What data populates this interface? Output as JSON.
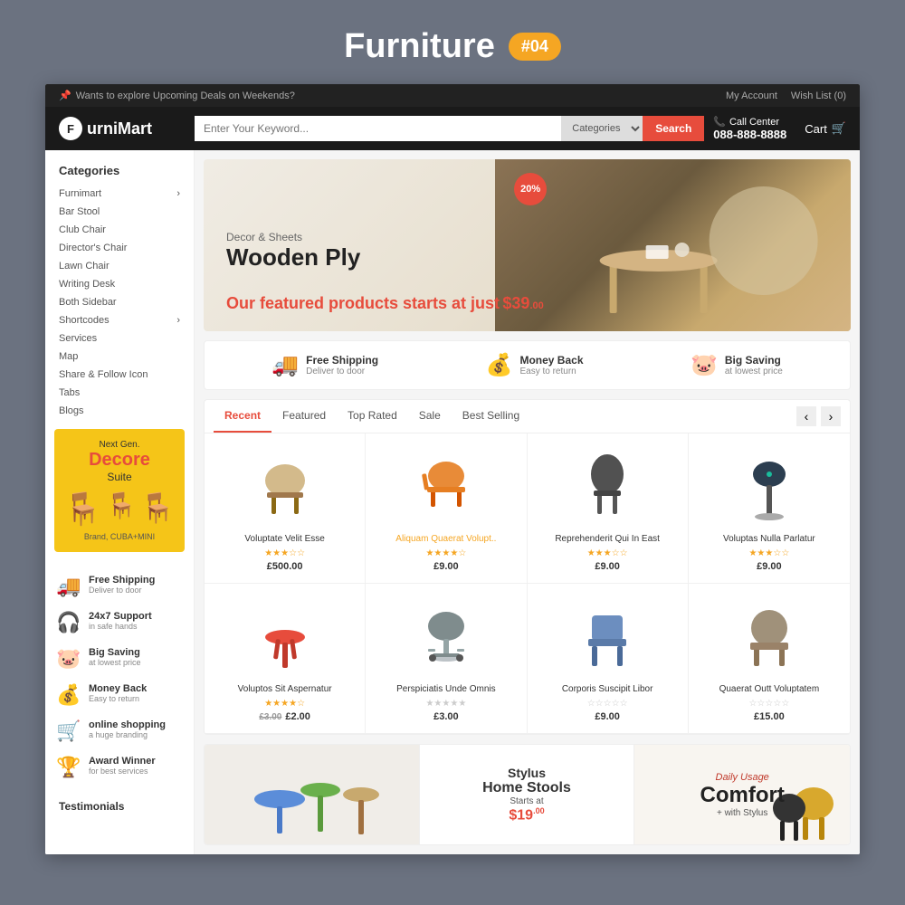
{
  "page": {
    "title": "Furniture",
    "badge": "#04",
    "bg_color": "#6b7280"
  },
  "topbar": {
    "announcement": "Wants to explore Upcoming Deals on Weekends?",
    "my_account": "My Account",
    "wish_list": "Wish List (0)",
    "pin_icon": "📌"
  },
  "header": {
    "logo_letter": "F",
    "logo_name": "urniMart",
    "search_placeholder": "Enter Your Keyword...",
    "search_cat": "Categories",
    "search_btn": "Search",
    "call_label": "Call Center",
    "call_number": "088-888-8888",
    "cart_label": "Cart",
    "cart_icon": "🛒"
  },
  "sidebar": {
    "categories_title": "Categories",
    "menu_items": [
      {
        "label": "Furnimart",
        "has_arrow": true
      },
      {
        "label": "Bar Stool",
        "has_arrow": false
      },
      {
        "label": "Club Chair",
        "has_arrow": false
      },
      {
        "label": "Director's Chair",
        "has_arrow": false
      },
      {
        "label": "Lawn Chair",
        "has_arrow": false
      },
      {
        "label": "Writing Desk",
        "has_arrow": false
      },
      {
        "label": "Both Sidebar",
        "has_arrow": false
      },
      {
        "label": "Shortcodes",
        "has_arrow": true
      },
      {
        "label": "Services",
        "has_arrow": false
      },
      {
        "label": "Map",
        "has_arrow": false
      },
      {
        "label": "Share & Follow Icon",
        "has_arrow": false
      },
      {
        "label": "Tabs",
        "has_arrow": false
      },
      {
        "label": "Blogs",
        "has_arrow": false
      }
    ],
    "promo": {
      "small": "Next Gen.",
      "big": "Decore",
      "medium": "Suite",
      "brand": "Brand, CUBA+MINI"
    },
    "features": [
      {
        "icon": "🚚",
        "title": "Free Shipping",
        "sub": "Deliver to door"
      },
      {
        "icon": "🎧",
        "title": "24x7 Support",
        "sub": "in safe hands"
      },
      {
        "icon": "🐷",
        "title": "Big Saving",
        "sub": "at lowest price"
      },
      {
        "icon": "💰",
        "title": "Money Back",
        "sub": "Easy to return"
      },
      {
        "icon": "🛒",
        "title": "online shopping",
        "sub": "a huge branding"
      },
      {
        "icon": "🏆",
        "title": "Award Winner",
        "sub": "for best services"
      }
    ],
    "testimonials_label": "Testimonials"
  },
  "hero": {
    "badge": "20%",
    "sub": "Decor & Sheets",
    "main": "Wooden Ply",
    "price_text": "Our featured products starts at just",
    "price": "$39",
    "price_cents": ".00"
  },
  "features_strip": [
    {
      "icon": "🚚",
      "title": "Free Shipping",
      "sub": "Deliver to door"
    },
    {
      "icon": "💰",
      "title": "Money Back",
      "sub": "Easy to return"
    },
    {
      "icon": "🐷",
      "title": "Big Saving",
      "sub": "at lowest price"
    }
  ],
  "product_tabs": {
    "tabs": [
      "Recent",
      "Featured",
      "Top Rated",
      "Sale",
      "Best Selling"
    ],
    "active": "Recent"
  },
  "products": [
    {
      "icon": "🪑",
      "name": "Voluptate Velit Esse",
      "price": "£500.00",
      "stars": 3,
      "color": "normal",
      "icon_style": "wooden-chair"
    },
    {
      "icon": "🪑",
      "name": "Aliquam Quaerat Volupt..",
      "price": "£9.00",
      "stars": 4,
      "color": "orange",
      "icon_style": "orange-chair"
    },
    {
      "icon": "🪑",
      "name": "Reprehenderit Qui In East",
      "price": "£9.00",
      "stars": 3,
      "color": "normal",
      "icon_style": "dark-chair"
    },
    {
      "icon": "🪑",
      "name": "Voluptas Nulla Parlatur",
      "price": "£9.00",
      "stars": 3,
      "color": "normal",
      "icon_style": "stool"
    },
    {
      "icon": "🪑",
      "name": "Voluptos Sit Aspernatur",
      "old_price": "£3.00",
      "price": "£2.00",
      "stars": 4,
      "color": "normal",
      "icon_style": "red-table"
    },
    {
      "icon": "🪑",
      "name": "Perspiciatis Unde Omnis",
      "price": "£3.00",
      "stars": 0,
      "color": "normal",
      "icon_style": "office-chair"
    },
    {
      "icon": "🪑",
      "name": "Corporis Suscipit Libor",
      "price": "£9.00",
      "stars": 0,
      "color": "normal",
      "icon_style": "dining-chair"
    },
    {
      "icon": "🪑",
      "name": "Quaerat Outt Voluptatem",
      "price": "£15.00",
      "stars": 0,
      "color": "normal",
      "icon_style": "lounge-chair"
    }
  ],
  "promo_banners": [
    {
      "type": "tables",
      "id": "banner-tables"
    },
    {
      "type": "stylus",
      "cursive": "Stylus",
      "big": "Home Stools",
      "sub": "Starts at",
      "price": "$19.00"
    },
    {
      "type": "comfort",
      "cursive": "Daily Usage",
      "big": "Comfort",
      "sub": "+ with Stylus"
    }
  ]
}
